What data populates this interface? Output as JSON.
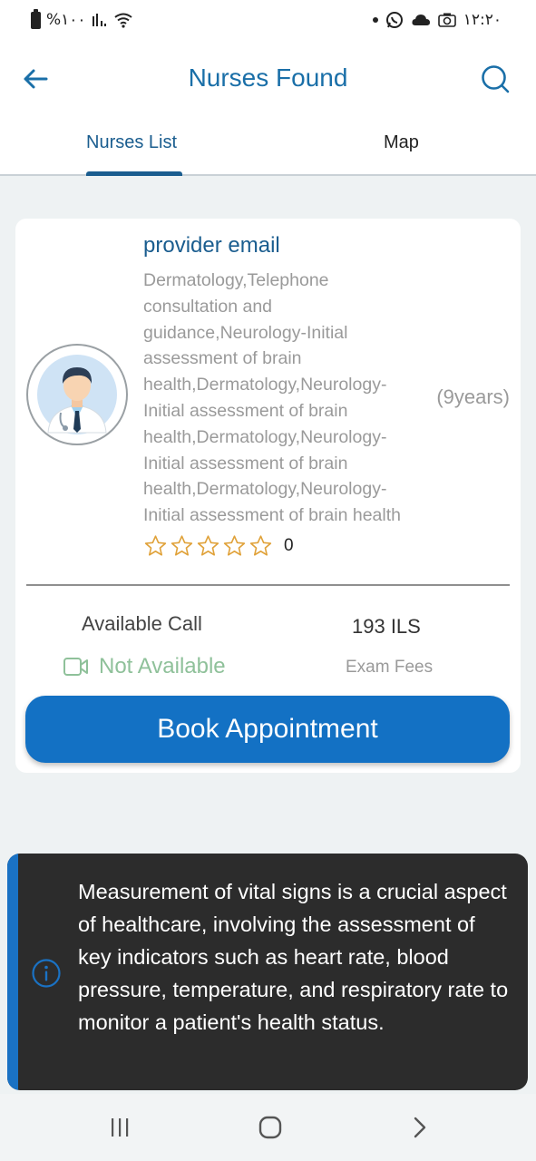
{
  "status_bar": {
    "battery_text": "%١٠٠",
    "time": "١٢:٢٠"
  },
  "header": {
    "title": "Nurses Found"
  },
  "tabs": [
    {
      "label": "Nurses List",
      "active": true
    },
    {
      "label": "Map",
      "active": false
    }
  ],
  "card": {
    "provider_name": "provider email",
    "specialties": "Dermatology,Telephone consultation and guidance,Neurology-Initial assessment of brain health,Dermatology,Neurology-Initial assessment of brain health,Dermatology,Neurology-Initial assessment of brain health,Dermatology,Neurology-Initial assessment of brain health",
    "experience": "(9years)",
    "rating": {
      "stars_filled": 0,
      "stars_total": 5,
      "value": "0"
    },
    "call_label": "Available Call",
    "call_status": "Not Available",
    "fee_amount": "193 ILS",
    "fee_label": "Exam Fees",
    "book_button": "Book Appointment"
  },
  "toast": {
    "message": "Measurement of vital signs is a crucial aspect of healthcare, involving the assessment of key indicators such as heart rate, blood pressure, temperature, and respiratory rate to monitor a patient's health status."
  },
  "colors": {
    "primary": "#1a5d8f",
    "button": "#1371c4",
    "star_outline": "#e0a23a",
    "not_available": "#8fc19a",
    "toast_bg": "#2c2c2c",
    "toast_accent": "#1a72c4"
  }
}
